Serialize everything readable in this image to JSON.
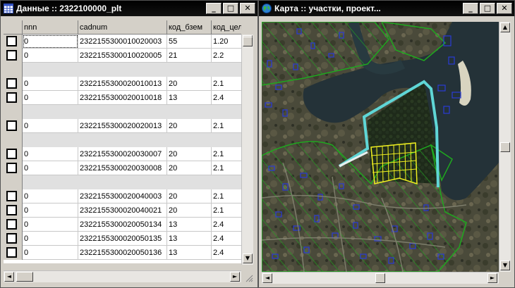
{
  "data_window": {
    "title": "Данные :: 2322100000_plt",
    "icon": "table-icon",
    "columns": [
      "nnn",
      "cadnum",
      "код_бзем",
      "код_цел"
    ],
    "rows": [
      {
        "nnn": "0",
        "cadnum": "2322155300010020003",
        "kod_bzem": "55",
        "kod_cel": "1.20"
      },
      {
        "nnn": "0",
        "cadnum": "2322155300010020005",
        "kod_bzem": "21",
        "kod_cel": "2.2"
      },
      null,
      {
        "nnn": "0",
        "cadnum": "2322155300020010013",
        "kod_bzem": "20",
        "kod_cel": "2.1"
      },
      {
        "nnn": "0",
        "cadnum": "2322155300020010018",
        "kod_bzem": "13",
        "kod_cel": "2.4"
      },
      null,
      {
        "nnn": "0",
        "cadnum": "2322155300020020013",
        "kod_bzem": "20",
        "kod_cel": "2.1"
      },
      null,
      {
        "nnn": "0",
        "cadnum": "2322155300020030007",
        "kod_bzem": "20",
        "kod_cel": "2.1"
      },
      {
        "nnn": "0",
        "cadnum": "2322155300020030008",
        "kod_bzem": "20",
        "kod_cel": "2.1"
      },
      null,
      {
        "nnn": "0",
        "cadnum": "2322155300020040003",
        "kod_bzem": "20",
        "kod_cel": "2.1"
      },
      {
        "nnn": "0",
        "cadnum": "2322155300020040021",
        "kod_bzem": "20",
        "kod_cel": "2.1"
      },
      {
        "nnn": "0",
        "cadnum": "2322155300020050134",
        "kod_bzem": "13",
        "kod_cel": "2.4"
      },
      {
        "nnn": "0",
        "cadnum": "2322155300020050135",
        "kod_bzem": "13",
        "kod_cel": "2.4"
      },
      {
        "nnn": "0",
        "cadnum": "2322155300020050136",
        "kod_bzem": "13",
        "kod_cel": "2.4"
      }
    ]
  },
  "map_window": {
    "title": "Карта :: участки, проект...",
    "icon": "globe-icon"
  },
  "title_buttons": {
    "minimize": "_",
    "maximize": "□",
    "close": "✕"
  },
  "scroll_glyphs": {
    "up": "▲",
    "down": "▼",
    "left": "◄",
    "right": "►"
  },
  "colors": {
    "parcel_green": "#1fa81f",
    "building_blue": "#2a3bd6",
    "project_cyan": "#5fd6d6",
    "plots_yellow": "#f0f020",
    "water": "#243238"
  }
}
